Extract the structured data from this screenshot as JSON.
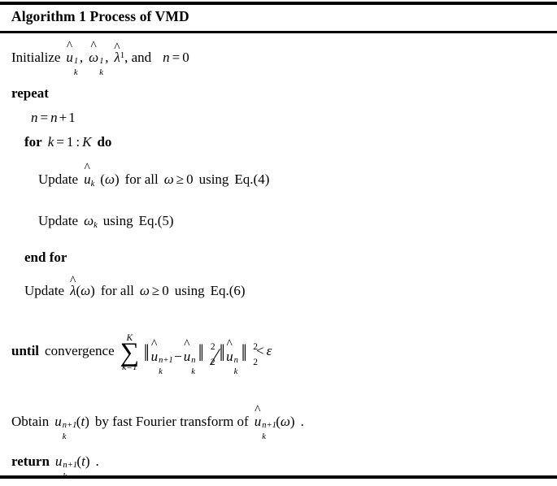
{
  "algorithm": {
    "title": "Algorithm 1 Process of VMD",
    "lines": {
      "initialize": {
        "keyword": "Initialize",
        "symbol_u": "u",
        "symbol_omega": "ω",
        "symbol_lambda": "λ",
        "hat": "^",
        "superscript": "1",
        "subscript": "k",
        "comma": ",",
        "and": ", and",
        "counter_var": "n",
        "equals": "=",
        "counter_value": "0"
      },
      "repeat": {
        "keyword": "repeat"
      },
      "increment": {
        "var": "n",
        "equals": "=",
        "rhs_var": "n",
        "plus": "+",
        "one": "1"
      },
      "for": {
        "keyword": "for",
        "index": "k",
        "equals": "=",
        "start": "1",
        "colon": ":",
        "end": "K",
        "do": "do"
      },
      "update_u": {
        "keyword": "Update",
        "symbol": "u",
        "hat": "^",
        "subscript": "k",
        "arg_open": "(",
        "arg": "ω",
        "arg_close": ")",
        "for_all": "for all",
        "cond_var": "ω",
        "cond_rel": "≥",
        "cond_value": "0",
        "using": "using",
        "equation": "Eq.(4)"
      },
      "update_omega": {
        "keyword": "Update",
        "symbol": "ω",
        "subscript": "k",
        "using": "using",
        "equation": "Eq.(5)"
      },
      "end_for": {
        "keyword": "end for"
      },
      "update_lambda": {
        "keyword": "Update",
        "symbol": "λ",
        "hat": "^",
        "arg_open": "(",
        "arg": "ω",
        "arg_close": ")",
        "for_all": "for all",
        "cond_var": "ω",
        "cond_rel": "≥",
        "cond_value": "0",
        "using": "using",
        "equation": "Eq.(6)"
      },
      "until": {
        "keyword": "until",
        "text": "convergence",
        "sum_glyph": "∑",
        "sum_upper": "K",
        "sum_lower": "k=1",
        "norm_bars": "‖",
        "term_symbol": "u",
        "hat": "^",
        "term_sub": "k",
        "term_sup_new": "n+1",
        "term_sup_old": "n",
        "minus": "−",
        "norm_power": "2",
        "norm_index": "2",
        "divide": "∕",
        "relation": "<",
        "epsilon": "ε"
      },
      "obtain": {
        "keyword": "Obtain",
        "symbol": "u",
        "subscript": "k",
        "superscript": "n+1",
        "arg_open": "(",
        "arg": "t",
        "arg_close": ")",
        "middle": "by fast Fourier transform of",
        "hat": "^",
        "hat_symbol": "u",
        "hat_subscript": "k",
        "hat_superscript": "n+1",
        "hat_arg_open": "(",
        "hat_arg": "ω",
        "hat_arg_close": ")",
        "period": "."
      },
      "return": {
        "keyword": "return",
        "symbol": "u",
        "subscript": "k",
        "superscript": "n+1",
        "arg_open": "(",
        "arg": "t",
        "arg_close": ")",
        "period": "."
      }
    },
    "style": {
      "text_color": "#000000",
      "background_color": "#ffffff",
      "rule_color": "#000000"
    }
  }
}
